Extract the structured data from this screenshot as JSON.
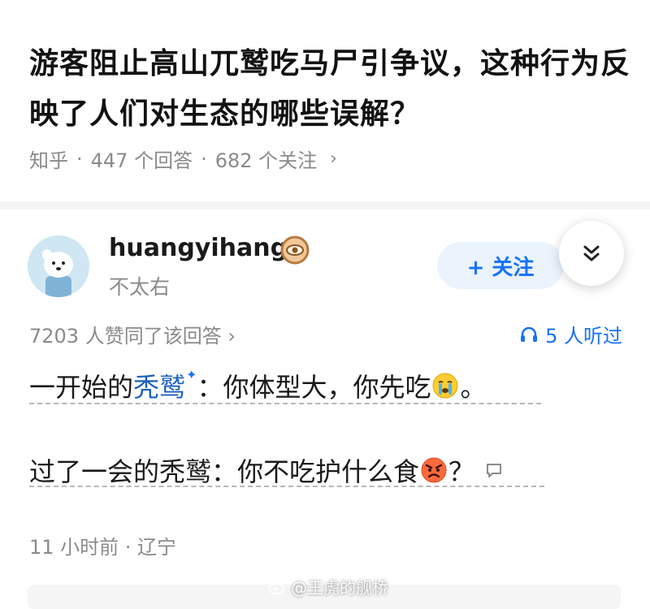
{
  "question": {
    "title": "游客阻止高山兀鹫吃马尸引争议，这种行为反映了人们对生态的哪些误解？",
    "source": "知乎",
    "answers": "447 个回答",
    "followers": "682 个关注",
    "separator": "·",
    "chevron": "›"
  },
  "author": {
    "name": "huangyihang",
    "bio": "不太右",
    "badge_icon": "gold-badge-icon",
    "follow_label": "+ 关注"
  },
  "answer": {
    "votes": "7203 人赞同了该回答 ›",
    "listeners": "5 人听过",
    "line1_prefix": "一开始的",
    "line1_term": "秃鹫",
    "line1_sparkle": "✦",
    "line1_suffix": "：你体型大，你先吃",
    "line1_end": "。",
    "line2_text": "过了一会的秃鹫：你不吃护什么食",
    "line2_end": "？",
    "time": "11 小时前 · 辽宁"
  },
  "watermark": {
    "text": "@王虎的舰桥"
  },
  "colors": {
    "accent": "#1772f6",
    "follow_bg": "#ebf3fd",
    "meta_text": "#8a8a8a",
    "title_text": "#121212"
  }
}
